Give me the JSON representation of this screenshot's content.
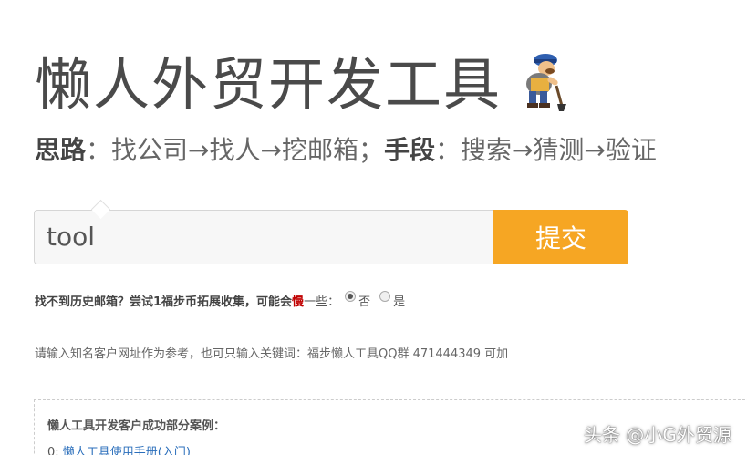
{
  "header": {
    "title": "懒人外贸开发工具",
    "tagline_label_1": "思路",
    "tagline_text_1": "：找公司→找人→挖邮箱；",
    "tagline_label_2": "手段",
    "tagline_text_2": "：搜索→猜测→验证"
  },
  "search": {
    "value": "tool",
    "submit_label": "提交"
  },
  "options": {
    "prefix": "找不到历史邮箱？尝试1福步币拓展收集，可能会",
    "slow_word": "慢",
    "suffix": "一些：",
    "choices": [
      {
        "label": "否",
        "checked": true
      },
      {
        "label": "是",
        "checked": false
      }
    ]
  },
  "hint": "请输入知名客户网址作为参考，也可只输入关键词：福步懒人工具QQ群 471444349 可加",
  "cases": {
    "title": "懒人工具开发客户成功部分案例：",
    "items": [
      {
        "prefix": "0: ",
        "link": "懒人工具使用手册(入门)"
      }
    ]
  },
  "watermark": "头条 @小G外贸源",
  "colors": {
    "accent": "#f6a623",
    "slow": "#c00000",
    "link": "#2a6ebb"
  },
  "icons": {
    "mascot": "digging-worker-icon"
  }
}
